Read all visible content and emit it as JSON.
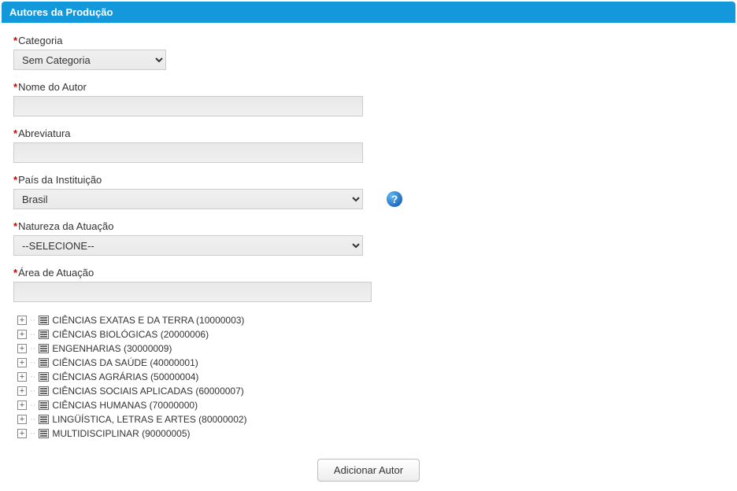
{
  "panel": {
    "title": "Autores da Produção"
  },
  "fields": {
    "categoria": {
      "label": "Categoria",
      "value": "Sem Categoria"
    },
    "nome_autor": {
      "label": "Nome do Autor",
      "value": ""
    },
    "abreviatura": {
      "label": "Abreviatura",
      "value": ""
    },
    "pais_instituicao": {
      "label": "País da Instituição",
      "value": "Brasil"
    },
    "natureza_atuacao": {
      "label": "Natureza da Atuação",
      "value": "--SELECIONE--"
    },
    "area_atuacao": {
      "label": "Área de Atuação",
      "value": ""
    }
  },
  "help": {
    "symbol": "?"
  },
  "tree": {
    "items": [
      {
        "label": "CIÊNCIAS EXATAS E DA TERRA (10000003)"
      },
      {
        "label": "CIÊNCIAS BIOLÓGICAS (20000006)"
      },
      {
        "label": "ENGENHARIAS (30000009)"
      },
      {
        "label": "CIÊNCIAS DA SAÚDE (40000001)"
      },
      {
        "label": "CIÊNCIAS AGRÁRIAS (50000004)"
      },
      {
        "label": "CIÊNCIAS SOCIAIS APLICADAS (60000007)"
      },
      {
        "label": "CIÊNCIAS HUMANAS (70000000)"
      },
      {
        "label": "LINGÜÍSTICA, LETRAS E ARTES (80000002)"
      },
      {
        "label": "MULTIDISCIPLINAR (90000005)"
      }
    ]
  },
  "buttons": {
    "add": "Adicionar Autor"
  }
}
